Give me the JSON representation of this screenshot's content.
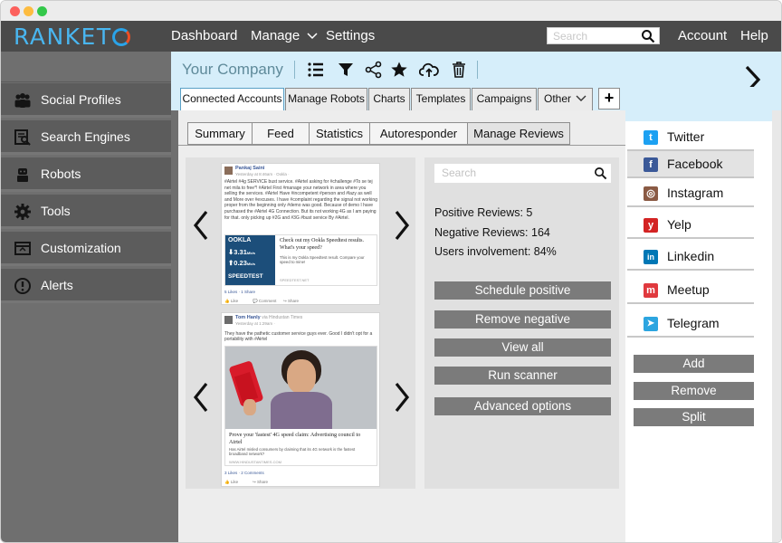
{
  "app": {
    "logo": "RANKETO"
  },
  "topnav": {
    "items": [
      "Dashboard",
      "Manage",
      "Settings"
    ],
    "search_placeholder": "Search",
    "account": "Account",
    "help": "Help"
  },
  "sidebar": {
    "items": [
      {
        "label": "Social Profiles",
        "icon": "users-icon"
      },
      {
        "label": "Search Engines",
        "icon": "search-engine-icon"
      },
      {
        "label": "Robots",
        "icon": "robot-icon"
      },
      {
        "label": "Tools",
        "icon": "gear-icon"
      },
      {
        "label": "Customization",
        "icon": "customize-icon"
      },
      {
        "label": "Alerts",
        "icon": "alert-icon"
      }
    ]
  },
  "company": {
    "name": "Your Company"
  },
  "tabs": [
    "Connected Accounts",
    "Manage Robots",
    "Charts",
    "Templates",
    "Campaigns",
    "Other"
  ],
  "subtabs": [
    "Summary",
    "Feed",
    "Statistics",
    "Autoresponder",
    "Manage Reviews"
  ],
  "feed": {
    "post1": {
      "author": "Pankaj Saini",
      "meta": "Yesterday at 8:46am · Ookla ·",
      "text": "#Airtel #4g SERVICE bust service. #Airtel asking for #challenge #To se tej net mila to free*! #Airtel First #manage your network in area where you selling the services. #Airtel Have #incompetent #person and #lazy as well and More over #excuses. I have #complaint regarding the signal not working proper from the beginning only #demo was good. Because of demo I have purchased the #Airtel 4G Connection. But its not working 4G as I am paying for that. only picking up #2G and #3G #bust service By #Airtel.",
      "brand": "OOKLA",
      "down": "3.31",
      "up": "0.23",
      "unit": "Mb/s",
      "speedtest": "SPEEDTEST",
      "link_title": "Check out my Ookla Speedtest results. What's your speed?",
      "link_desc": "This is my Ookla Speedtest result. Compare your speed to mine!",
      "link_url": "SPEEDTEST.NET",
      "stats": "5 Likes · 1 Share",
      "actions": [
        "Like",
        "Comment",
        "Share"
      ]
    },
    "post2": {
      "author": "Tom Hanly",
      "via": "via Hindustan Times",
      "meta": "Yesterday at 1:29am ·",
      "text": "They have the pathetic customer service guys ever. Good I didn't opt for a portability with #Airtel",
      "headline": "Prove your 'fastest' 4G speed claim: Advertising council to Airtel",
      "desc": "Has Airtel misled consumers by claiming that its 4G network is the fastest broadband network?",
      "url": "WWW.HINDUSTANTIMES.COM",
      "stats": "3 Likes · 2 Comments",
      "actions": [
        "Like",
        "Share"
      ]
    }
  },
  "reviews": {
    "search_placeholder": "Search",
    "positive": "Positive Reviews: 5",
    "negative": "Negative Reviews: 164",
    "involvement": "Users involvement: 84%",
    "buttons": [
      "Schedule positive",
      "Remove negative",
      "View all",
      "Run scanner",
      "Advanced options"
    ]
  },
  "social": {
    "items": [
      {
        "label": "Twitter",
        "color": "#1da1f2",
        "glyph": "t"
      },
      {
        "label": "Facebook",
        "color": "#3b5998",
        "glyph": "f"
      },
      {
        "label": "Instagram",
        "color": "#8a5a44",
        "glyph": "◎"
      },
      {
        "label": "Yelp",
        "color": "#d32323",
        "glyph": "y"
      },
      {
        "label": "Linkedin",
        "color": "#0077b5",
        "glyph": "in"
      },
      {
        "label": "Meetup",
        "color": "#e0393e",
        "glyph": "m"
      },
      {
        "label": "Telegram",
        "color": "#2ca5e0",
        "glyph": "➤"
      }
    ],
    "buttons": [
      "Add",
      "Remove",
      "Split"
    ]
  },
  "colors": {
    "brand": "#49b6f0",
    "accent_bar": "#d6eefa",
    "topnav": "#4a4a4a",
    "sidebar": "#5c5c5c",
    "button_gray": "#7b7b7b"
  }
}
